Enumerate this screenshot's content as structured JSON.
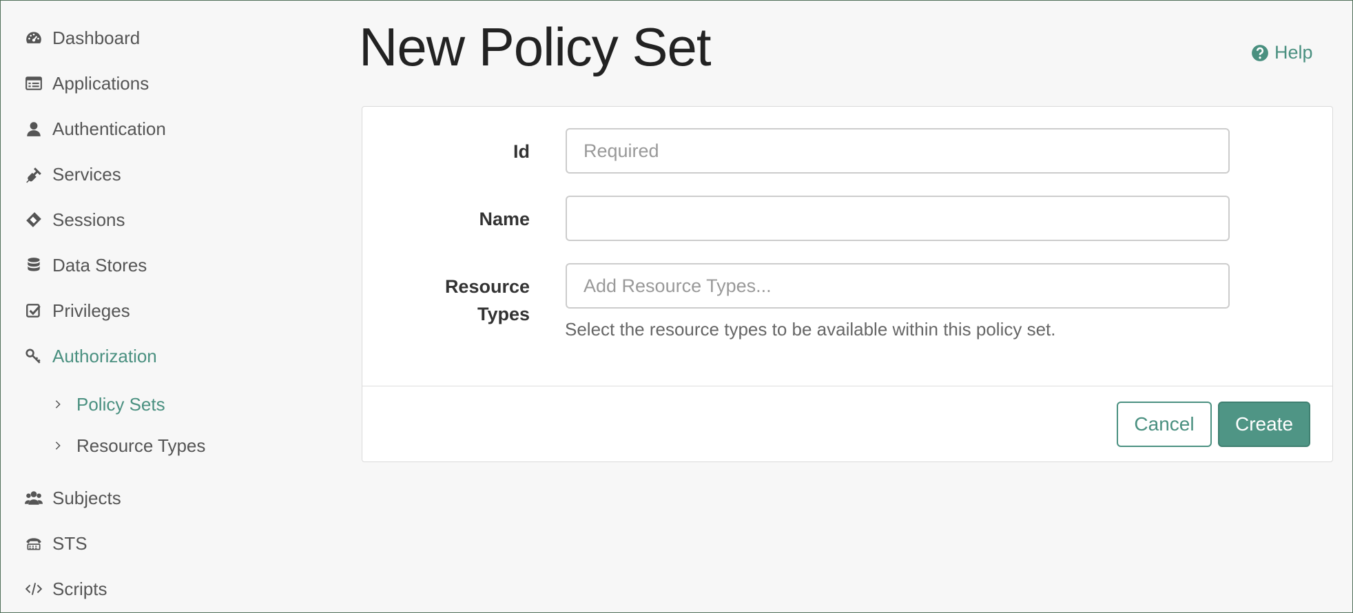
{
  "sidebar": {
    "items": [
      {
        "label": "Dashboard",
        "icon": "dashboard-icon"
      },
      {
        "label": "Applications",
        "icon": "applications-icon"
      },
      {
        "label": "Authentication",
        "icon": "user-icon"
      },
      {
        "label": "Services",
        "icon": "plug-icon"
      },
      {
        "label": "Sessions",
        "icon": "ticket-icon"
      },
      {
        "label": "Data Stores",
        "icon": "database-icon"
      },
      {
        "label": "Privileges",
        "icon": "checkbox-icon"
      },
      {
        "label": "Authorization",
        "icon": "key-icon",
        "active": true
      },
      {
        "label": "Subjects",
        "icon": "users-icon"
      },
      {
        "label": "STS",
        "icon": "sts-icon"
      },
      {
        "label": "Scripts",
        "icon": "code-icon"
      }
    ],
    "sub_items": [
      {
        "label": "Policy Sets",
        "active": true
      },
      {
        "label": "Resource Types"
      }
    ]
  },
  "main": {
    "title": "New Policy Set",
    "help_label": "Help",
    "form": {
      "id_label": "Id",
      "id_placeholder": "Required",
      "name_label": "Name",
      "name_value": "",
      "resource_types_label_line1": "Resource",
      "resource_types_label_line2": "Types",
      "resource_types_placeholder": "Add Resource Types...",
      "resource_types_help": "Select the resource types to be available within this policy set."
    },
    "buttons": {
      "cancel": "Cancel",
      "create": "Create"
    }
  },
  "colors": {
    "accent": "#4a9080",
    "create_button": "#4f9585",
    "text": "#555555",
    "background": "#f7f7f7"
  }
}
